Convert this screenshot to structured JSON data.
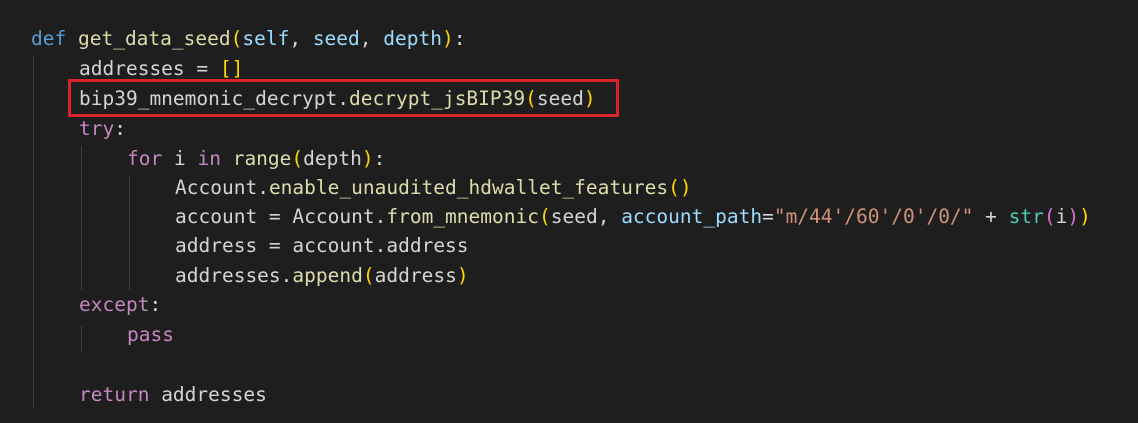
{
  "editor": {
    "accent_highlight": "#d8232a",
    "lines": [
      {
        "id": "line-def",
        "tokens": [
          {
            "t": "def",
            "c": "kw"
          },
          {
            "t": " ",
            "c": "def"
          },
          {
            "t": "get_data_seed",
            "c": "fn"
          },
          {
            "t": "(",
            "c": "b1"
          },
          {
            "t": "self",
            "c": "var"
          },
          {
            "t": ", ",
            "c": "def"
          },
          {
            "t": "seed",
            "c": "var"
          },
          {
            "t": ", ",
            "c": "def"
          },
          {
            "t": "depth",
            "c": "var"
          },
          {
            "t": ")",
            "c": "b1"
          },
          {
            "t": ":",
            "c": "def"
          }
        ]
      },
      {
        "id": "line-addresses-init",
        "tokens": [
          {
            "t": "addresses",
            "c": "def"
          },
          {
            "t": " = ",
            "c": "def"
          },
          {
            "t": "[]",
            "c": "b1"
          }
        ]
      },
      {
        "id": "line-decrypt",
        "tokens": [
          {
            "t": "bip39_mnemonic_decrypt",
            "c": "def"
          },
          {
            "t": ".",
            "c": "def"
          },
          {
            "t": "decrypt_jsBIP39",
            "c": "fn"
          },
          {
            "t": "(",
            "c": "b1"
          },
          {
            "t": "seed",
            "c": "def"
          },
          {
            "t": ")",
            "c": "b1"
          }
        ]
      },
      {
        "id": "line-try",
        "tokens": [
          {
            "t": "try",
            "c": "ctl"
          },
          {
            "t": ":",
            "c": "def"
          }
        ]
      },
      {
        "id": "line-for",
        "tokens": [
          {
            "t": "for",
            "c": "ctl"
          },
          {
            "t": " i ",
            "c": "def"
          },
          {
            "t": "in",
            "c": "ctl"
          },
          {
            "t": " ",
            "c": "def"
          },
          {
            "t": "range",
            "c": "fn"
          },
          {
            "t": "(",
            "c": "b1"
          },
          {
            "t": "depth",
            "c": "def"
          },
          {
            "t": ")",
            "c": "b1"
          },
          {
            "t": ":",
            "c": "def"
          }
        ]
      },
      {
        "id": "line-enable",
        "tokens": [
          {
            "t": "Account",
            "c": "def"
          },
          {
            "t": ".",
            "c": "def"
          },
          {
            "t": "enable_unaudited_hdwallet_features",
            "c": "fn"
          },
          {
            "t": "()",
            "c": "b1"
          }
        ]
      },
      {
        "id": "line-account",
        "tokens": [
          {
            "t": "account",
            "c": "def"
          },
          {
            "t": " = ",
            "c": "def"
          },
          {
            "t": "Account",
            "c": "def"
          },
          {
            "t": ".",
            "c": "def"
          },
          {
            "t": "from_mnemonic",
            "c": "fn"
          },
          {
            "t": "(",
            "c": "b1"
          },
          {
            "t": "seed",
            "c": "def"
          },
          {
            "t": ", ",
            "c": "def"
          },
          {
            "t": "account_path",
            "c": "var"
          },
          {
            "t": "=",
            "c": "def"
          },
          {
            "t": "\"m/44'/60'/0'/0/\"",
            "c": "str"
          },
          {
            "t": " + ",
            "c": "def"
          },
          {
            "t": "str",
            "c": "cls"
          },
          {
            "t": "(",
            "c": "b2"
          },
          {
            "t": "i",
            "c": "def"
          },
          {
            "t": ")",
            "c": "b2"
          },
          {
            "t": ")",
            "c": "b1"
          }
        ]
      },
      {
        "id": "line-address",
        "tokens": [
          {
            "t": "address",
            "c": "def"
          },
          {
            "t": " = ",
            "c": "def"
          },
          {
            "t": "account",
            "c": "def"
          },
          {
            "t": ".",
            "c": "def"
          },
          {
            "t": "address",
            "c": "def"
          }
        ]
      },
      {
        "id": "line-append",
        "tokens": [
          {
            "t": "addresses",
            "c": "def"
          },
          {
            "t": ".",
            "c": "def"
          },
          {
            "t": "append",
            "c": "fn"
          },
          {
            "t": "(",
            "c": "b1"
          },
          {
            "t": "address",
            "c": "def"
          },
          {
            "t": ")",
            "c": "b1"
          }
        ]
      },
      {
        "id": "line-except",
        "tokens": [
          {
            "t": "except",
            "c": "ctl"
          },
          {
            "t": ":",
            "c": "def"
          }
        ]
      },
      {
        "id": "line-pass",
        "tokens": [
          {
            "t": "pass",
            "c": "ctl"
          }
        ]
      },
      {
        "id": "line-blank",
        "tokens": []
      },
      {
        "id": "line-return",
        "tokens": [
          {
            "t": "return",
            "c": "ctl"
          },
          {
            "t": " addresses",
            "c": "def"
          }
        ]
      }
    ]
  }
}
